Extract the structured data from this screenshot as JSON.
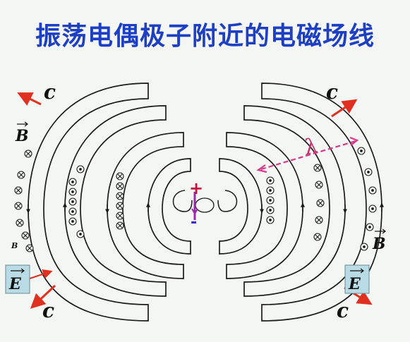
{
  "title": "振荡电偶极子附近的电磁场线",
  "labels": {
    "c_top_left": "c",
    "c_top_right": "c",
    "c_bottom_left": "c",
    "c_bottom_right": "c",
    "b_left": "B",
    "b_right": "B",
    "b_small": "B",
    "e_left": "E",
    "e_right": "E",
    "lambda": "λ",
    "plus": "+",
    "minus": "-"
  },
  "colors": {
    "title": "#1d3fc4",
    "arrow": "#e03020",
    "dipole": "#9a2aa8",
    "plus": "#d0103a",
    "minus": "#3a2ad0",
    "e_box": "#b9dbe6",
    "line": "#1c1c1c"
  }
}
